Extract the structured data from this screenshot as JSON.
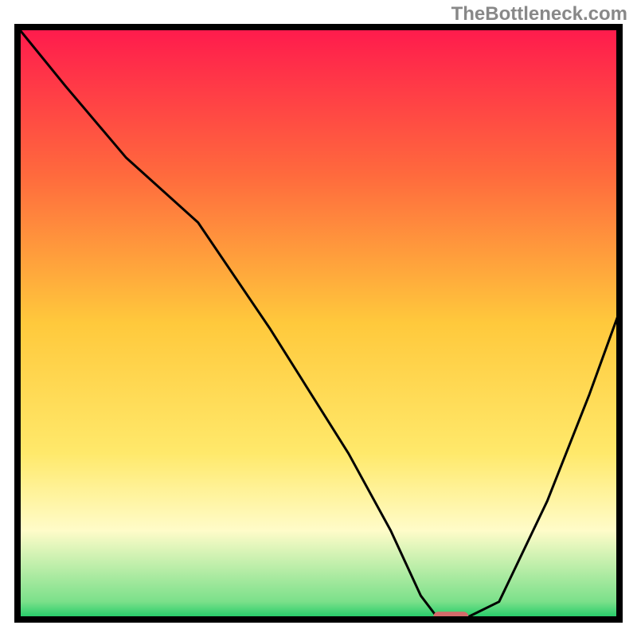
{
  "watermark": "TheBottleneck.com",
  "chart_data": {
    "type": "line",
    "title": "",
    "xlabel": "",
    "ylabel": "",
    "xlim": [
      0,
      100
    ],
    "ylim": [
      0,
      100
    ],
    "x": [
      0,
      8,
      18,
      30,
      42,
      55,
      62,
      67,
      70,
      74,
      80,
      88,
      95,
      100
    ],
    "y": [
      100,
      90,
      78,
      67,
      49,
      28,
      15,
      4,
      0,
      0,
      3,
      20,
      38,
      52
    ],
    "marker": {
      "x": 72,
      "y": 0.5
    },
    "gradient_stops": [
      {
        "offset": 0.0,
        "color": "#ff1a4d"
      },
      {
        "offset": 0.25,
        "color": "#ff6a3d"
      },
      {
        "offset": 0.5,
        "color": "#ffc93c"
      },
      {
        "offset": 0.72,
        "color": "#ffe96b"
      },
      {
        "offset": 0.85,
        "color": "#fffcc9"
      },
      {
        "offset": 0.97,
        "color": "#7be08a"
      },
      {
        "offset": 1.0,
        "color": "#17c964"
      }
    ],
    "frame_color": "#000000",
    "line_color": "#000000",
    "marker_color": "#d46a6a"
  }
}
